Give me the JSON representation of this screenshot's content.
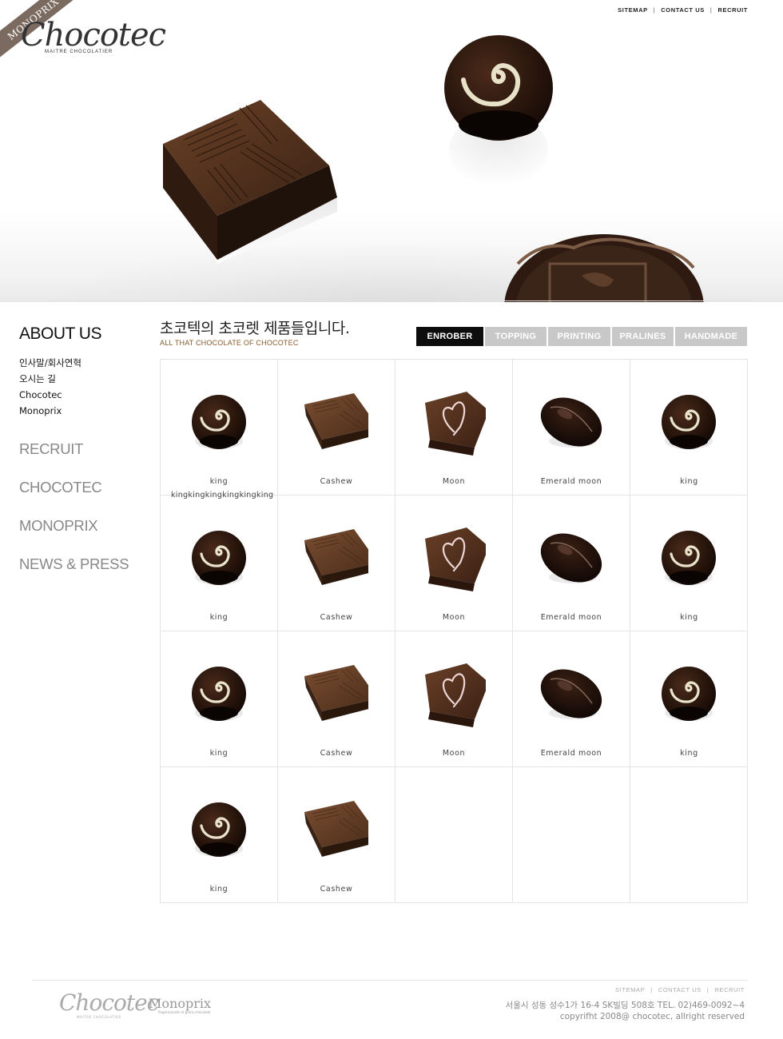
{
  "brand": {
    "ribbon": "MONOPRIX",
    "logo": "Chocotec",
    "logo_sub": "MAITRE CHOCOLATIER"
  },
  "top_links": [
    "SITEMAP",
    "CONTACT US",
    "RECRUIT"
  ],
  "sidebar": {
    "title": "ABOUT US",
    "sub_items": [
      "인사말/회사연혁",
      "오시는 길",
      "Chocotec",
      "Monoprix"
    ],
    "main_items": [
      "RECRUIT",
      "CHOCOTEC",
      "MONOPRIX",
      "NEWS & PRESS"
    ]
  },
  "content": {
    "headline": "초코텍의 초코렛 제품들입니다.",
    "subline": "ALL THAT  CHOCOLATE OF CHOCOTEC",
    "tabs": [
      "ENROBER",
      "TOPPING",
      "PRINTING",
      "PRALINES",
      "HANDMADE"
    ],
    "active_tab": "ENROBER"
  },
  "products": [
    {
      "name": "king",
      "kind": "swirl"
    },
    {
      "name": "Cashew",
      "kind": "square"
    },
    {
      "name": "Moon",
      "kind": "heart"
    },
    {
      "name": "Emerald moon",
      "kind": "oval"
    },
    {
      "name": "king",
      "kind": "swirl"
    },
    {
      "name": "king",
      "kind": "swirl"
    },
    {
      "name": "Cashew",
      "kind": "square"
    },
    {
      "name": "Moon",
      "kind": "heart"
    },
    {
      "name": "Emerald moon",
      "kind": "oval"
    },
    {
      "name": "king",
      "kind": "swirl"
    },
    {
      "name": "king",
      "kind": "swirl"
    },
    {
      "name": "Cashew",
      "kind": "square"
    },
    {
      "name": "Moon",
      "kind": "heart"
    },
    {
      "name": "Emerald moon",
      "kind": "oval"
    },
    {
      "name": "king",
      "kind": "swirl"
    },
    {
      "name": "king",
      "kind": "swirl"
    },
    {
      "name": "Cashew",
      "kind": "square"
    },
    {
      "name": "",
      "kind": ""
    },
    {
      "name": "",
      "kind": ""
    },
    {
      "name": "",
      "kind": ""
    }
  ],
  "overflow_label": "kingkingkingkingkingking",
  "footer": {
    "links": [
      "SITEMAP",
      "CONTACT US",
      "RECRUIT"
    ],
    "logo1": "Chocotec",
    "logo1_sub": "MAITRE CHOCOLATIER",
    "logo2": "Monoprix",
    "logo2_sub": "fingerscandle et grans chocolate",
    "address": "서울시 성동 성수1가 16-4 SK빌딩 508호 TEL. 02)469-0092~4",
    "copyright": "copyrifht 2008@ chocotec, allright reserved"
  }
}
